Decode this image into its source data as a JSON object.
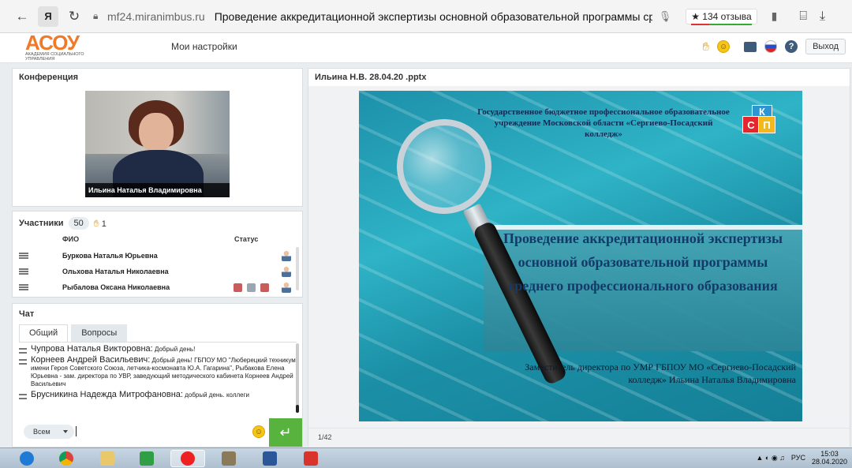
{
  "browser": {
    "url": "mf24.miranimbus.ru",
    "tab_title": "Проведение аккредитационной экспертизы основной образовательной программы ср...",
    "reviews": "★ 134 отзыва",
    "ya_label": "Я"
  },
  "app": {
    "logo_text": "АСОУ",
    "logo_sub": "Академия социального управления",
    "settings_label": "Мои настройки",
    "exit_label": "Выход"
  },
  "conference": {
    "title": "Конференция",
    "speaker_caption": "Ильина Наталья Владимировна"
  },
  "participants": {
    "title": "Участники",
    "count": "50",
    "raised_hands": "1",
    "col_fio": "ФИО",
    "col_status": "Статус",
    "rows": [
      {
        "name": "Буркова Наталья Юрьевна"
      },
      {
        "name": "Ольхова Наталья Николаевна"
      },
      {
        "name": "Рыбалова Оксана Николаевна"
      }
    ]
  },
  "chat": {
    "title": "Чат",
    "tabs": [
      "Общий",
      "Вопросы"
    ],
    "messages": [
      {
        "author": "Чупрова Наталья Викторовна:",
        "text": "Добрый день!"
      },
      {
        "author": "Корнеев Андрей Васильевич:",
        "text": "Добрый день! ГБПОУ МО \"Люберецкий техникум имени Героя Советского Союза, летчика-космонавта Ю.А. Гагарина\", Рыбакова Елена Юрьевна - зам. директора по УВР, заведующий методического кабинета Корнеев Андрей Васильевич"
      },
      {
        "author": "Брусникина Надежда Митрофановна:",
        "text": "добрый день. коллеги"
      }
    ],
    "recipient": "Всем"
  },
  "presentation": {
    "title": "Ильина Н.В. 28.04.20 .pptx",
    "page": "1/42",
    "slide": {
      "org": "Государственное бюджетное профессиональное образовательное учреждение Московской области «Сергиево-Посадский колледж»",
      "heading": "Проведение аккредитационной экспертизы основной образовательной программы среднего профессионального образования",
      "signature": "Заместитель директора по УМР ГБПОУ МО «Сергиево-Посадский колледж» Ильина Наталья Владимировна",
      "logo_letters": [
        "С",
        "П",
        "К"
      ]
    }
  },
  "taskbar": {
    "lang": "РУС",
    "time": "15:03",
    "date": "28.04.2020"
  },
  "colors": {
    "accent_orange": "#f07a2a",
    "send_green": "#57b33d",
    "slide_teal": "#2fb3c6"
  }
}
